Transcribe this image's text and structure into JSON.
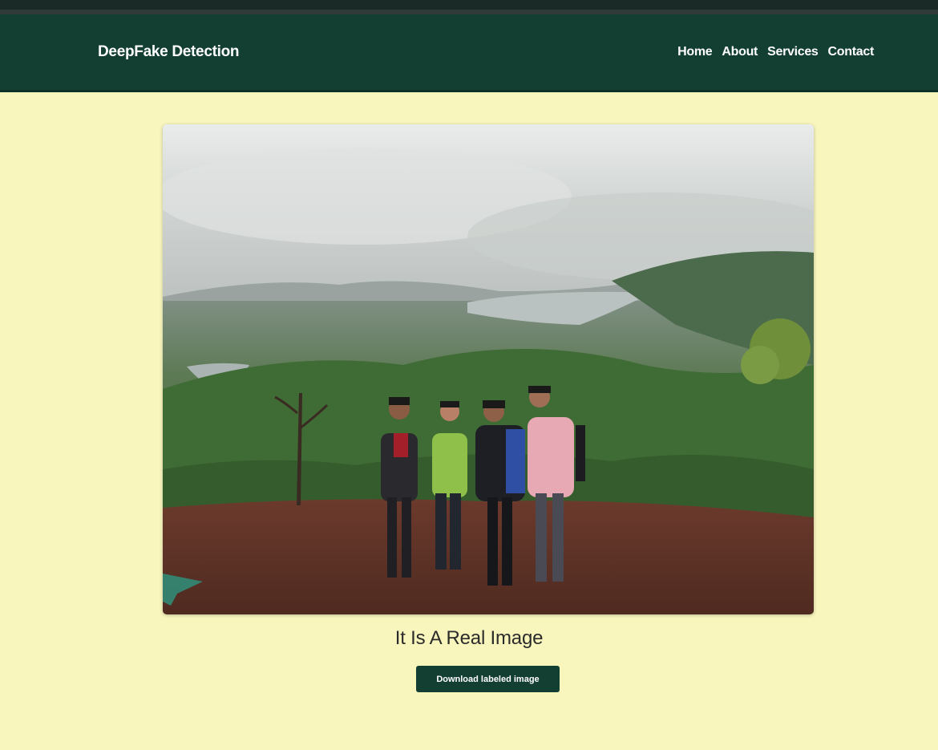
{
  "navbar": {
    "brand": "DeepFake Detection",
    "links": [
      {
        "label": "Home"
      },
      {
        "label": "About"
      },
      {
        "label": "Services"
      },
      {
        "label": "Contact"
      }
    ],
    "background": "#133f32"
  },
  "result": {
    "text": "It Is A Real Image",
    "download_label": "Download labeled image"
  },
  "colors": {
    "page_background": "#f8f6bd",
    "accent": "#133f32"
  }
}
